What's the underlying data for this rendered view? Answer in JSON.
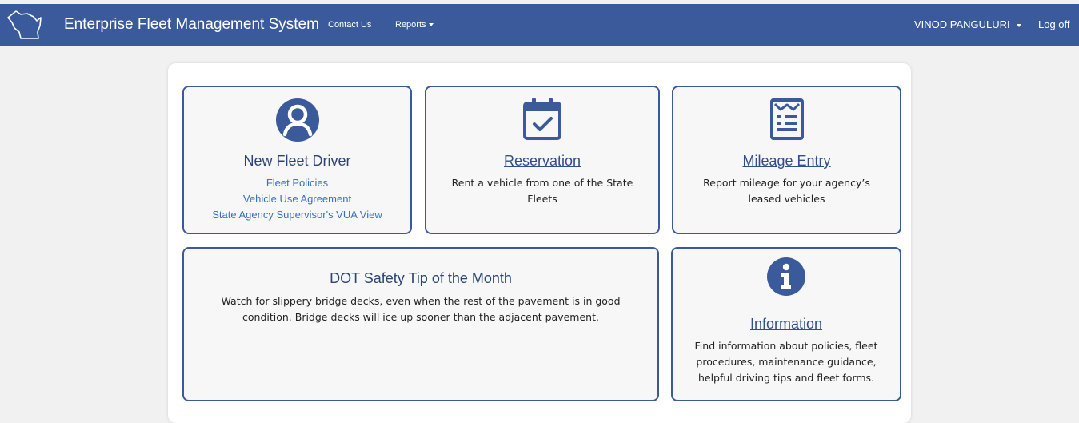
{
  "navbar": {
    "title": "Enterprise Fleet Management System",
    "contact_label": "Contact Us",
    "reports_label": "Reports",
    "user_label": "VINOD PANGULURI",
    "logoff_label": "Log off",
    "logo_icon": "wisconsin-outline-icon",
    "bg_color": "#3a5a9b"
  },
  "cards": {
    "new_driver": {
      "icon": "user-circle-icon",
      "title": "New Fleet Driver",
      "links": [
        "Fleet Policies",
        "Vehicle Use Agreement",
        "State Agency Supervisor's VUA View"
      ]
    },
    "reservation": {
      "icon": "calendar-check-icon",
      "title": "Reservation",
      "text": "Rent a vehicle from one of the State Fleets"
    },
    "mileage": {
      "icon": "mileage-form-icon",
      "title": "Mileage Entry",
      "text": "Report mileage for your agency’s leased vehicles"
    },
    "safety": {
      "title": "DOT Safety Tip of the Month",
      "text": "Watch for slippery bridge decks, even when the rest of the pavement is in good condition. Bridge decks will ice up sooner than the adjacent pavement."
    },
    "information": {
      "icon": "info-circle-icon",
      "title": "Information",
      "text": "Find information about policies, fleet procedures, maintenance guidance, helpful driving tips and fleet forms."
    }
  }
}
